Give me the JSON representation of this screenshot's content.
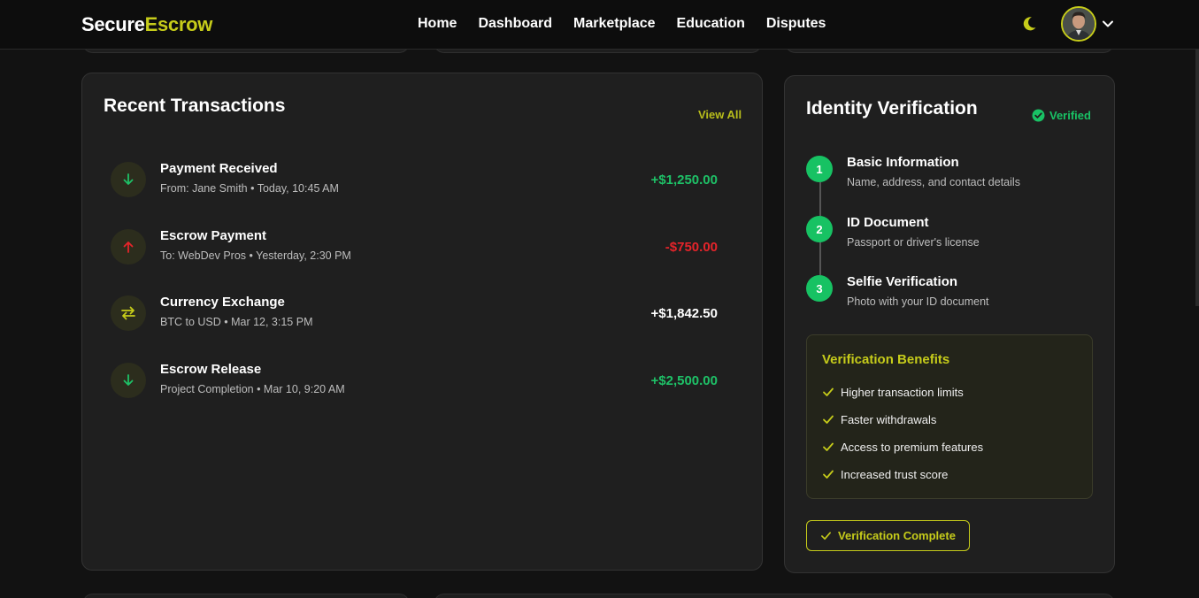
{
  "header": {
    "logo_part1": "Secure",
    "logo_part2": "Escrow",
    "nav": [
      "Home",
      "Dashboard",
      "Marketplace",
      "Education",
      "Disputes"
    ],
    "theme_icon": "moon-icon",
    "profile_chevron": "chevron-down-icon"
  },
  "transactions": {
    "title": "Recent Transactions",
    "view_all": "View All",
    "items": [
      {
        "title": "Payment Received",
        "sub": "From: Jane Smith • Today, 10:45 AM",
        "amount": "+$1,250.00",
        "icon": "arrow-down-icon",
        "amount_color": "#1ec167",
        "icon_color": "#1ec167"
      },
      {
        "title": "Escrow Payment",
        "sub": "To: WebDev Pros • Yesterday, 2:30 PM",
        "amount": "-$750.00",
        "icon": "arrow-up-icon",
        "amount_color": "#e5242a",
        "icon_color": "#e5242a"
      },
      {
        "title": "Currency Exchange",
        "sub": "BTC to USD • Mar 12, 3:15 PM",
        "amount": "+$1,842.50",
        "icon": "exchange-icon",
        "amount_color": "#ffffff",
        "icon_color": "#c6cc1a"
      },
      {
        "title": "Escrow Release",
        "sub": "Project Completion • Mar 10, 9:20 AM",
        "amount": "+$2,500.00",
        "icon": "arrow-down-icon",
        "amount_color": "#1ec167",
        "icon_color": "#1ec167"
      }
    ]
  },
  "identity": {
    "title": "Identity Verification",
    "status": "Verified",
    "steps": [
      {
        "num": "1",
        "title": "Basic Information",
        "sub": "Name, address, and contact details"
      },
      {
        "num": "2",
        "title": "ID Document",
        "sub": "Passport or driver's license"
      },
      {
        "num": "3",
        "title": "Selfie Verification",
        "sub": "Photo with your ID document"
      }
    ],
    "benefits_title": "Verification Benefits",
    "benefits": [
      "Higher transaction limits",
      "Faster withdrawals",
      "Access to premium features",
      "Increased trust score"
    ],
    "button": "Verification Complete"
  },
  "colors": {
    "accent": "#c6cc1a",
    "success": "#1ec167",
    "danger": "#e5242a",
    "background": "#121212",
    "card": "#1f1f1f"
  }
}
